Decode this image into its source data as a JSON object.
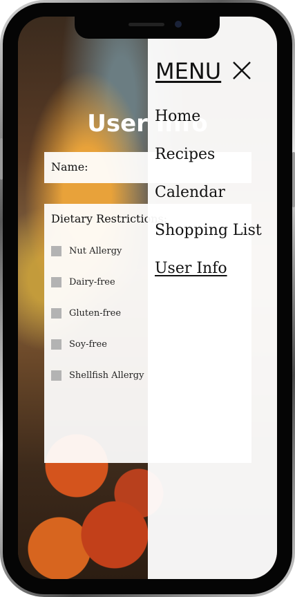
{
  "page": {
    "title": "User Info",
    "name_label": "Name:",
    "diet_title": "Dietary Restrictions:",
    "restrictions": [
      {
        "label": "Nut Allergy",
        "checked": false
      },
      {
        "label": "Dairy-free",
        "checked": false
      },
      {
        "label": "Gluten-free",
        "checked": false
      },
      {
        "label": "Soy-free",
        "checked": false
      },
      {
        "label": "Shellfish Allergy",
        "checked": false
      }
    ]
  },
  "menu": {
    "title": "MENU",
    "close_icon": "close-icon",
    "items": [
      {
        "label": "Home",
        "active": false
      },
      {
        "label": "Recipes",
        "active": false
      },
      {
        "label": "Calendar",
        "active": false
      },
      {
        "label": "Shopping List",
        "active": false
      },
      {
        "label": "User Info",
        "active": true
      }
    ]
  },
  "colors": {
    "panel": "#ffffff",
    "checkbox": "#b3b3b3",
    "text": "#111111"
  }
}
